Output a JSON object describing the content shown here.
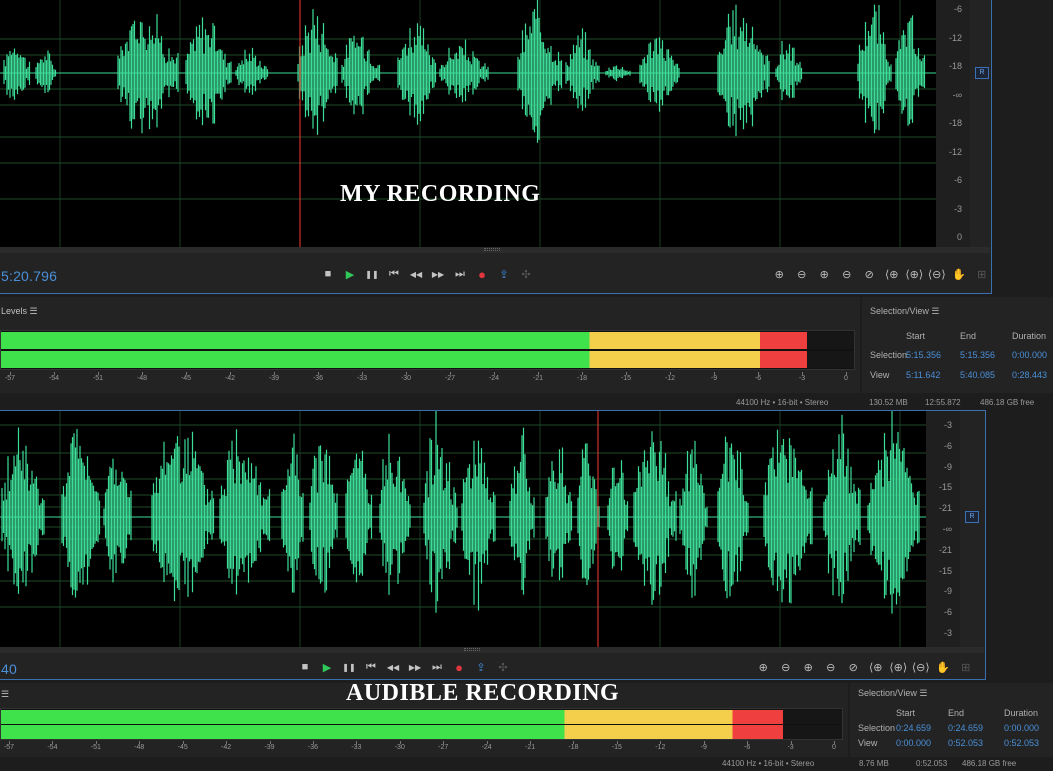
{
  "top": {
    "timecode": "5:20.796",
    "caption": "MY RECORDING",
    "channel_label": "R",
    "ruler": [
      "-6",
      "-12",
      "-18",
      "-∞",
      "-18",
      "-12",
      "-6",
      "-3",
      "0"
    ],
    "levels_title": "Levels",
    "meter_fill": {
      "green": 0.69,
      "yellow": 0.89,
      "red": 0.945
    },
    "scale": [
      "-57",
      "-54",
      "-51",
      "-48",
      "-45",
      "-42",
      "-39",
      "-36",
      "-33",
      "-30",
      "-27",
      "-24",
      "-21",
      "-18",
      "-15",
      "-12",
      "-9",
      "-6",
      "-3",
      "0"
    ],
    "selection_view": {
      "title": "Selection/View",
      "headers": [
        "Start",
        "End",
        "Duration"
      ],
      "rows": [
        {
          "label": "Selection",
          "start": "5:15.356",
          "end": "5:15.356",
          "duration": "0:00.000"
        },
        {
          "label": "View",
          "start": "5:11.642",
          "end": "5:40.085",
          "duration": "0:28.443"
        }
      ]
    },
    "status": {
      "format": "44100 Hz • 16-bit • Stereo",
      "size": "130.52 MB",
      "duration": "12:55.872",
      "free": "486.18 GB free"
    }
  },
  "bottom": {
    "timecode": "40",
    "caption": "AUDIBLE RECORDING",
    "channel_label": "R",
    "ruler": [
      "-3",
      "-6",
      "-9",
      "-15",
      "-21",
      "-∞",
      "-21",
      "-15",
      "-9",
      "-6",
      "-3"
    ],
    "meter_fill": {
      "green": 0.67,
      "yellow": 0.87,
      "red": 0.93
    },
    "scale": [
      "-57",
      "-54",
      "-51",
      "-48",
      "-45",
      "-42",
      "-39",
      "-36",
      "-33",
      "-30",
      "-27",
      "-24",
      "-21",
      "-18",
      "-15",
      "-12",
      "-9",
      "-6",
      "-3",
      "0"
    ],
    "selection_view": {
      "title": "Selection/View",
      "headers": [
        "Start",
        "End",
        "Duration"
      ],
      "rows": [
        {
          "label": "Selection",
          "start": "0:24.659",
          "end": "0:24.659",
          "duration": "0:00.000"
        },
        {
          "label": "View",
          "start": "0:00.000",
          "end": "0:52.053",
          "duration": "0:52.053"
        }
      ]
    },
    "status": {
      "format": "44100 Hz • 16-bit • Stereo",
      "size": "8.76 MB",
      "duration": "0:52.053",
      "free": "486.18 GB free"
    }
  },
  "transport_icons": [
    "stop-icon",
    "play-icon",
    "pause-icon",
    "go-to-start-icon",
    "rewind-icon",
    "fast-forward-icon",
    "go-to-end-icon",
    "record-icon",
    "loop-icon",
    "skip-selection-icon"
  ],
  "zoom_icons": [
    "zoom-in-amplitude-icon",
    "zoom-out-amplitude-icon",
    "zoom-in-time-icon",
    "zoom-out-time-icon",
    "zoom-out-full-icon",
    "zoom-in-point-icon",
    "zoom-selection-icon",
    "zoom-out-point-icon",
    "zoom-fit-icon",
    "zoom-reset-icon"
  ],
  "colors": {
    "waveform": "#3ddc97",
    "accent": "#4a90d9",
    "playhead": "#d0302a"
  }
}
